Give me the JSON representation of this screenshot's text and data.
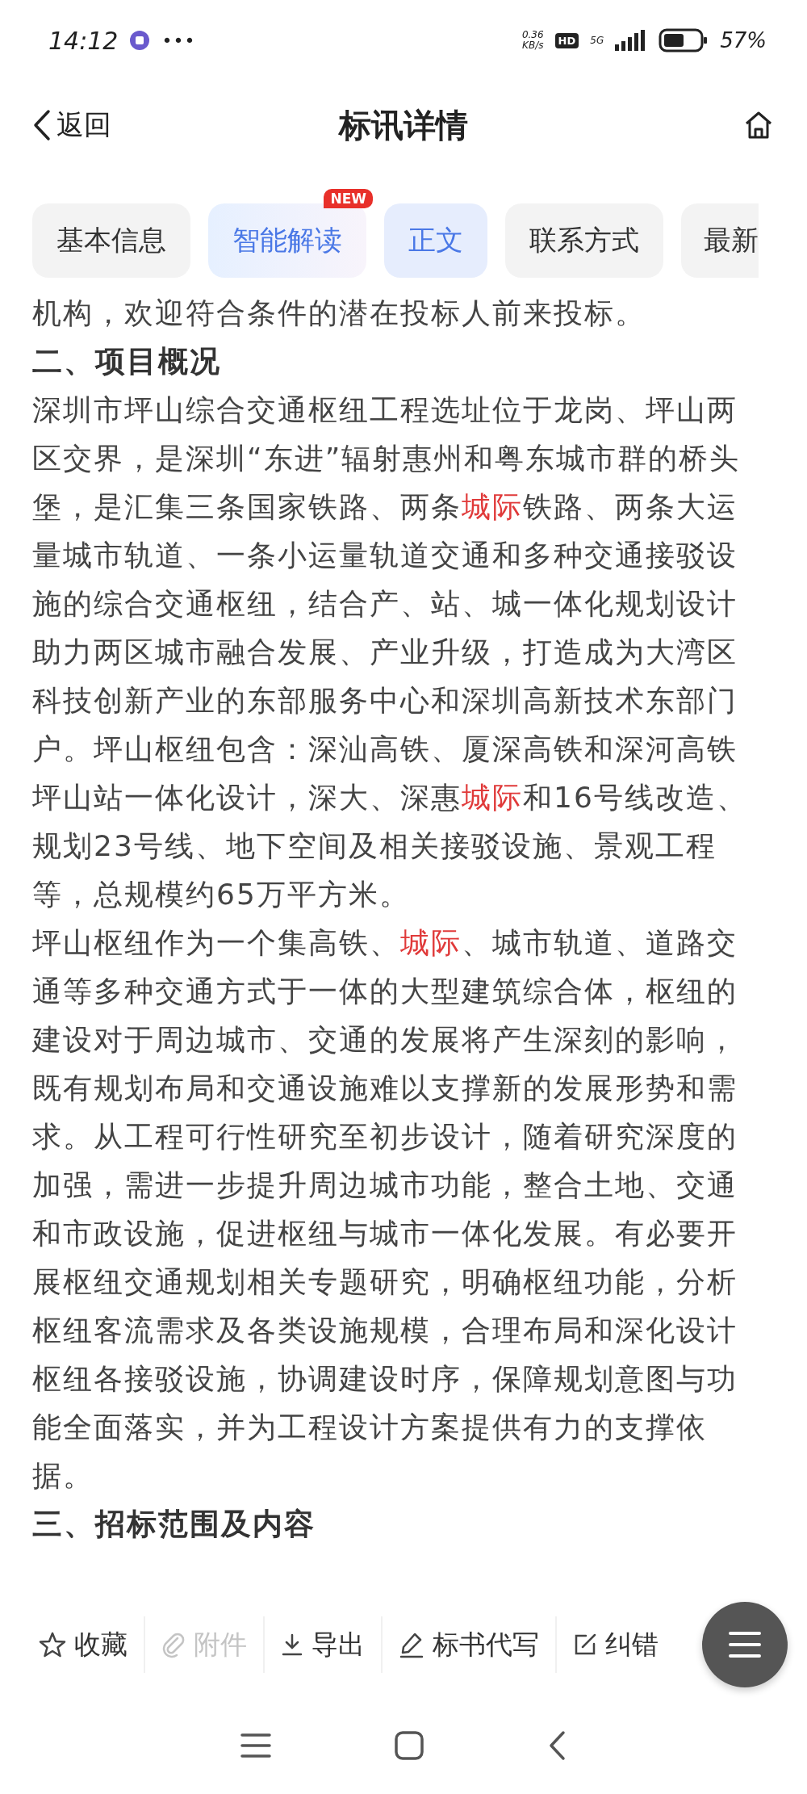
{
  "status_bar": {
    "time": "14:12",
    "more": "•••",
    "speed_value": "0.36",
    "speed_unit": "KB/s",
    "hd": "HD",
    "network": "5G",
    "battery_level_text": "57%"
  },
  "nav": {
    "back": "返回",
    "title": "标讯详情"
  },
  "tabs": [
    {
      "label": "基本信息",
      "selected": false
    },
    {
      "label": "智能解读",
      "selected": false,
      "badge": "NEW",
      "kind": "ai"
    },
    {
      "label": "正文",
      "selected": true
    },
    {
      "label": "联系方式",
      "selected": false
    },
    {
      "label": "最新",
      "selected": false
    }
  ],
  "content": [
    {
      "kind": "text",
      "segments": [
        {
          "text": "机构，欢迎符合条件的潜在投标人前来投标。",
          "highlight": false
        }
      ]
    },
    {
      "kind": "heading",
      "text": "二、项目概况"
    },
    {
      "kind": "text",
      "segments": [
        {
          "text": "深圳市坪山综合交通枢纽工程选址位于龙岗、坪山两区交界，是深圳“东进”辐射惠州和粤东城市群的桥头堡，是汇集三条国家铁路、两条",
          "highlight": false
        },
        {
          "text": "城际",
          "highlight": true
        },
        {
          "text": "铁路、两条大运量城市轨道、一条小运量轨道交通和多种交通接驳设施的综合交通枢纽，结合产、站、城一体化规划设计助力两区城市融合发展、产业升级，打造成为大湾区科技创新产业的东部服务中心和深圳高新技术东部门户。坪山枢纽包含：深汕高铁、厦深高铁和深河高铁坪山站一体化设计，深大、深惠",
          "highlight": false
        },
        {
          "text": "城际",
          "highlight": true
        },
        {
          "text": "和16号线改造、规划23号线、地下空间及相关接驳设施、景观工程等，总规模约65万平方米。",
          "highlight": false
        }
      ]
    },
    {
      "kind": "text",
      "segments": [
        {
          "text": "坪山枢纽作为一个集高铁、",
          "highlight": false
        },
        {
          "text": "城际",
          "highlight": true
        },
        {
          "text": "、城市轨道、道路交通等多种交通方式于一体的大型建筑综合体，枢纽的建设对于周边城市、交通的发展将产生深刻的影响，既有规划布局和交通设施难以支撑新的发展形势和需求。从工程可行性研究至初步设计，随着研究深度的加强，需进一步提升周边城市功能，整合土地、交通和市政设施，促进枢纽与城市一体化发展。有必要开展枢纽交通规划相关专题研究，明确枢纽功能，分析枢纽客流需求及各类设施规模，合理布局和深化设计枢纽各接驳设施，协调建设时序，保障规划意图与功能全面落实，并为工程设计方案提供有力的支撑依据。",
          "highlight": false
        }
      ]
    },
    {
      "kind": "heading",
      "text": "三、招标范围及内容"
    }
  ],
  "toolbar": [
    {
      "kind": "star",
      "label": "收藏",
      "disabled": false
    },
    {
      "kind": "clip",
      "label": "附件",
      "disabled": true
    },
    {
      "kind": "download",
      "label": "导出",
      "disabled": false
    },
    {
      "kind": "pen",
      "label": "标书代写",
      "disabled": false
    },
    {
      "kind": "edit",
      "label": "纠错",
      "disabled": false
    }
  ]
}
